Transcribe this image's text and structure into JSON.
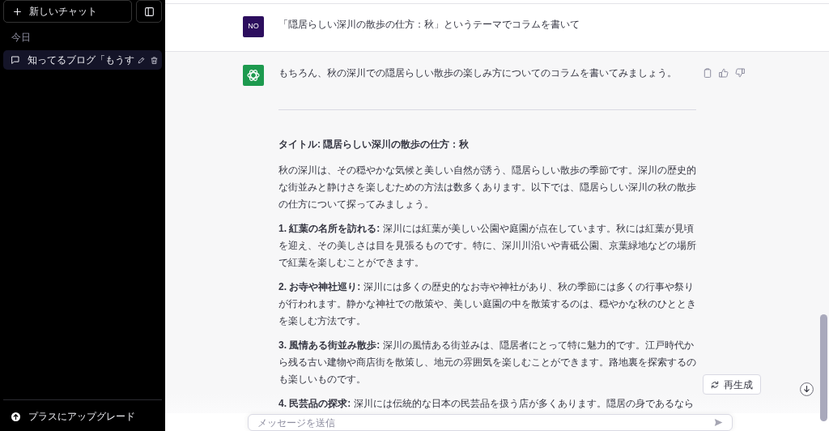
{
  "sidebar": {
    "new_chat": "新しいチャット",
    "section_label": "今日",
    "conversations": [
      {
        "title": "知ってるブログ「もうす",
        "selected": true
      }
    ],
    "upgrade": "プラスにアップグレード"
  },
  "messages": [
    {
      "kind": "user",
      "avatar": "NO",
      "text": "「隠居らしい深川の散歩の仕方：秋」というテーマでコラムを書いて"
    },
    {
      "kind": "assistant",
      "intro": "もちろん、秋の深川での隠居らしい散歩の楽しみ方についてのコラムを書いてみましょう。",
      "title": "タイトル: 隠居らしい深川の散歩の仕方：秋",
      "paragraphs": [
        "秋の深川は、その穏やかな気候と美しい自然が誘う、隠居らしい散歩の季節です。深川の歴史的な街並みと静けさを楽しむための方法は数多くあります。以下では、隠居らしい深川の秋の散歩の仕方について探ってみましょう。",
        "**1. 紅葉の名所を訪れる:** 深川には紅葉が美しい公園や庭園が点在しています。秋には紅葉が見頃を迎え、その美しさは目を見張るものです。特に、深川川沿いや青砥公園、京葉緑地などの場所で紅葉を楽しむことができます。",
        "**2. お寺や神社巡り:** 深川には多くの歴史的なお寺や神社があり、秋の季節には多くの行事や祭りが行われます。静かな神社での散策や、美しい庭園の中を散策するのは、穏やかな秋のひとときを楽しむ方法です。",
        "**3. 風情ある街並み散歩:** 深川の風情ある街並みは、隠居者にとって特に魅力的です。江戸時代から残る古い建物や商店街を散策し、地元の雰囲気を楽しむことができます。路地裏を探索するのも楽しいものです。",
        "**4. 民芸品の探求:** 深川には伝統的な日本の民芸品を扱う店が多くあります。隠居の身であるなら"
      ]
    }
  ],
  "regenerate_button": "再生成",
  "composer": {
    "placeholder": "メッセージを送信"
  }
}
